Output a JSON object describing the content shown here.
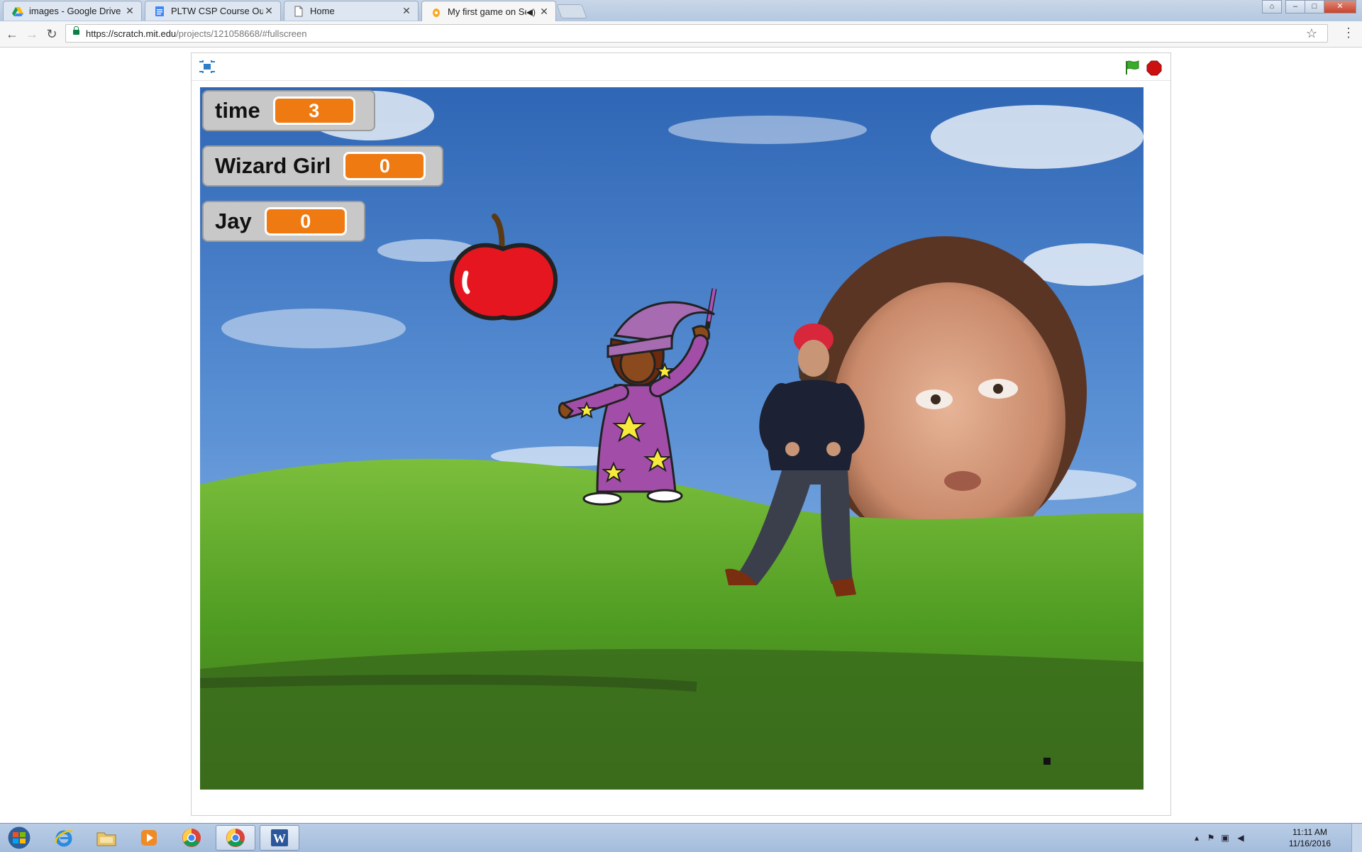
{
  "browser": {
    "tabs": [
      {
        "title": "images - Google Drive",
        "active": false,
        "icon": "google-drive-icon"
      },
      {
        "title": "PLTW CSP Course Outlin",
        "active": false,
        "icon": "google-docs-icon"
      },
      {
        "title": "Home",
        "active": false,
        "icon": "page-icon"
      },
      {
        "title": "My first game on Scra",
        "active": true,
        "icon": "scratch-icon",
        "audio": true
      }
    ],
    "url_host": "https://scratch.mit.edu",
    "url_path": "/projects/121058668/#fullscreen",
    "window_controls": [
      "–",
      "□",
      "✕"
    ]
  },
  "player": {
    "monitors": [
      {
        "label": "time",
        "value": "3"
      },
      {
        "label": "Wizard Girl",
        "value": "0"
      },
      {
        "label": "Jay",
        "value": "0"
      }
    ],
    "colors": {
      "monitor_value": "#ef7a12",
      "monitor_bg": "#c8c8c8",
      "flag": "#3aab2a",
      "stop": "#cc1010"
    }
  },
  "taskbar": {
    "pinned": [
      "windows-start-icon",
      "internet-explorer-icon",
      "file-explorer-icon",
      "media-player-icon",
      "chrome-icon",
      "chrome-active-icon",
      "word-icon"
    ],
    "clock_time": "11:11 AM",
    "clock_date": "11/16/2016"
  }
}
